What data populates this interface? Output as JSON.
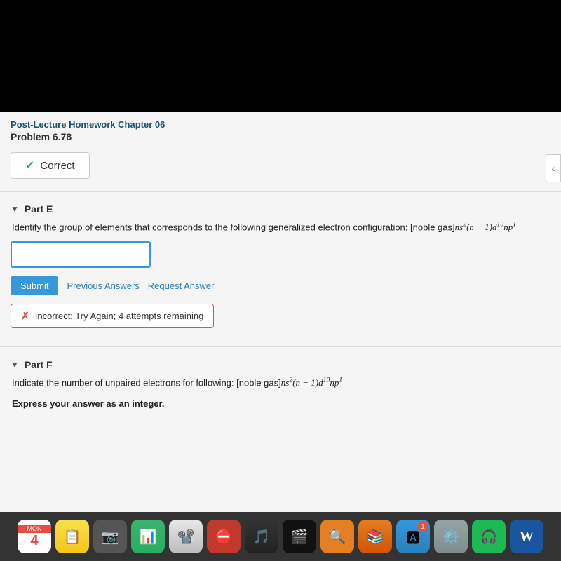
{
  "header": {
    "course_title": "Post-Lecture Homework Chapter 06",
    "problem_number": "Problem 6.78"
  },
  "correct_section": {
    "label": "Correct"
  },
  "part_e": {
    "title": "Part E",
    "question_prefix": "Identify the group of elements that corresponds to the following generalized electron configuration: [noble gas]",
    "formula": "ns²(n − 1)d¹⁰np¹",
    "answer_placeholder": "",
    "submit_label": "Submit",
    "previous_answers_label": "Previous Answers",
    "request_answer_label": "Request Answer",
    "incorrect_message": "Incorrect; Try Again; 4 attempts remaining"
  },
  "part_f": {
    "title": "Part F",
    "question_prefix": "Indicate the number of unpaired electrons for following: [noble gas]",
    "formula": "ns²(n − 1)d¹⁰np¹",
    "instruction": "Express your answer as an integer."
  },
  "chevron": {
    "symbol": "‹"
  },
  "dock": {
    "items": [
      {
        "icon": "📅",
        "color": "white",
        "type": "calendar",
        "date": "4"
      },
      {
        "icon": "🗒️",
        "color": "yellow",
        "type": "notes"
      },
      {
        "icon": "📷",
        "color": "gray",
        "type": "facetime"
      },
      {
        "icon": "📊",
        "color": "green",
        "type": "charts"
      },
      {
        "icon": "📽️",
        "color": "gray",
        "type": "keynote"
      },
      {
        "icon": "⛔",
        "color": "red",
        "type": "stop"
      },
      {
        "icon": "🎵",
        "color": "gray",
        "type": "music"
      },
      {
        "icon": "🎬",
        "color": "dark",
        "type": "video"
      },
      {
        "icon": "🎭",
        "color": "orange",
        "type": "spotlight"
      },
      {
        "icon": "📚",
        "color": "orange",
        "type": "books"
      },
      {
        "icon": "🅰️",
        "color": "blue",
        "type": "appstore",
        "badge": "1"
      },
      {
        "icon": "⚙️",
        "color": "gray",
        "type": "settings"
      },
      {
        "icon": "🎵",
        "color": "green",
        "type": "spotify"
      },
      {
        "icon": "📝",
        "color": "blue",
        "type": "word"
      }
    ]
  }
}
